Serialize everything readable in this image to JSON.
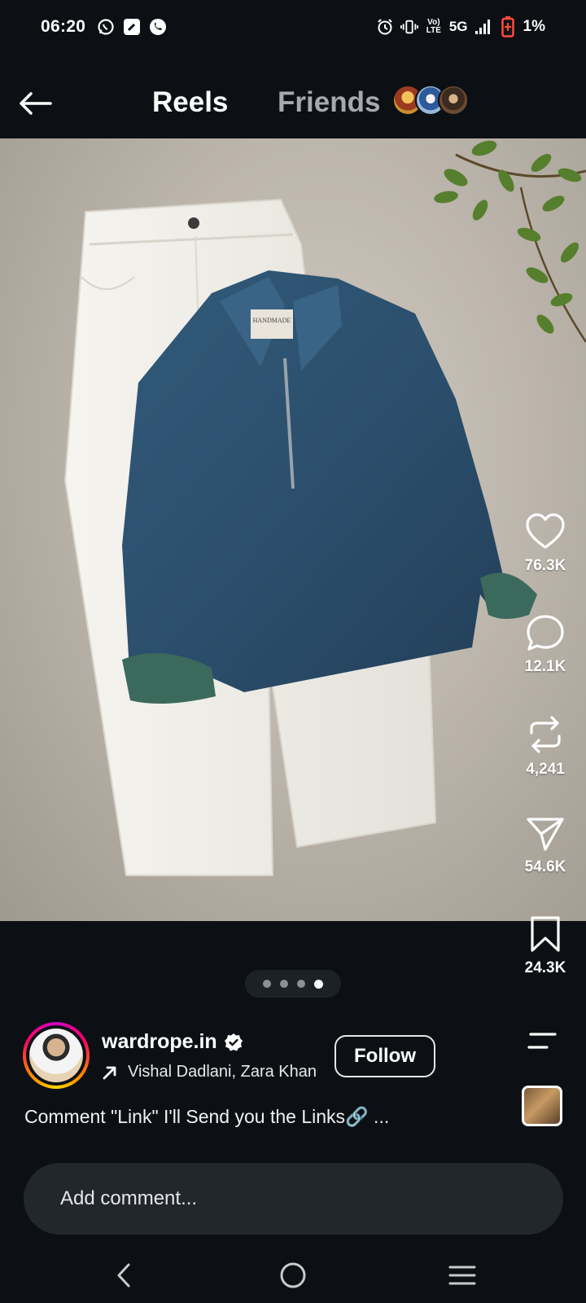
{
  "status_bar": {
    "time": "06:20",
    "network": "5G",
    "volte": "Vo) LTE",
    "battery": "1%",
    "left_icons": [
      "whatsapp-icon",
      "edit-icon",
      "phone-icon"
    ],
    "right_icons": [
      "alarm-icon",
      "vibrate-icon",
      "signal-icon",
      "battery-low-icon"
    ]
  },
  "nav": {
    "tab_reels": "Reels",
    "tab_friends": "Friends",
    "friend_avatar_colors": [
      "#c9902f",
      "#2d5a9a",
      "#6b4a34"
    ]
  },
  "actions": {
    "likes": "76.3K",
    "comments": "12.1K",
    "reposts": "4,241",
    "shares": "54.6K",
    "saves": "24.3K"
  },
  "pager": {
    "count": 4,
    "active_index": 3
  },
  "author": {
    "username": "wardrope.in",
    "verified": true,
    "audio": "Vishal Dadlani, Zara Khan",
    "follow_label": "Follow"
  },
  "caption": "Comment \"Link\" I'll Send you the Links🔗 ...",
  "comment": {
    "placeholder": "Add comment..."
  },
  "media": {
    "label_text": "HANDMADE",
    "colors": {
      "denim": "#2f5270",
      "cuff": "#3b6a5c",
      "pants": "#f3f1ec",
      "background": "#c6c0b6",
      "leaves": "#4e7a28"
    }
  }
}
